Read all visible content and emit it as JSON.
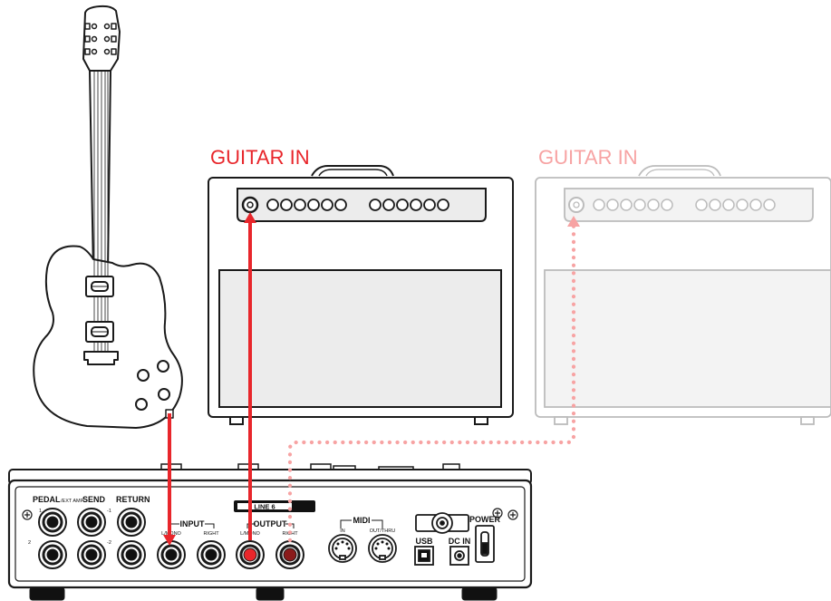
{
  "colors": {
    "cable_red": "#e8262b",
    "cable_faded": "#f7a3a3",
    "outline": "#1a1a1a",
    "faded_outline": "#bcbcbc",
    "grille": "#ececec",
    "output_right_jack": "#8a1b1b"
  },
  "amp_primary": {
    "label": "GUITAR IN"
  },
  "amp_secondary": {
    "label": "GUITAR IN"
  },
  "unit": {
    "brand": "LINE 6",
    "pedal_label": "PEDAL",
    "pedal_sub": "/EXT AMP",
    "send_label": "SEND",
    "return_label": "RETURN",
    "input_label": "INPUT",
    "input_left": "L/MONO",
    "input_right": "RIGHT",
    "output_label": "OUTPUT",
    "output_left": "L/MONO",
    "output_right": "RIGHT",
    "midi_label": "MIDI",
    "midi_in": "IN",
    "midi_out": "OUT/THRU",
    "usb_label": "USB",
    "dcin_label": "DC IN",
    "power_label": "POWER",
    "num_1": "1",
    "num_2": "2",
    "num_neg1": "-1",
    "num_neg2": "-2"
  },
  "icons": [
    "guitar-icon",
    "amp-icon",
    "line6-unit-icon",
    "cable-icon"
  ]
}
